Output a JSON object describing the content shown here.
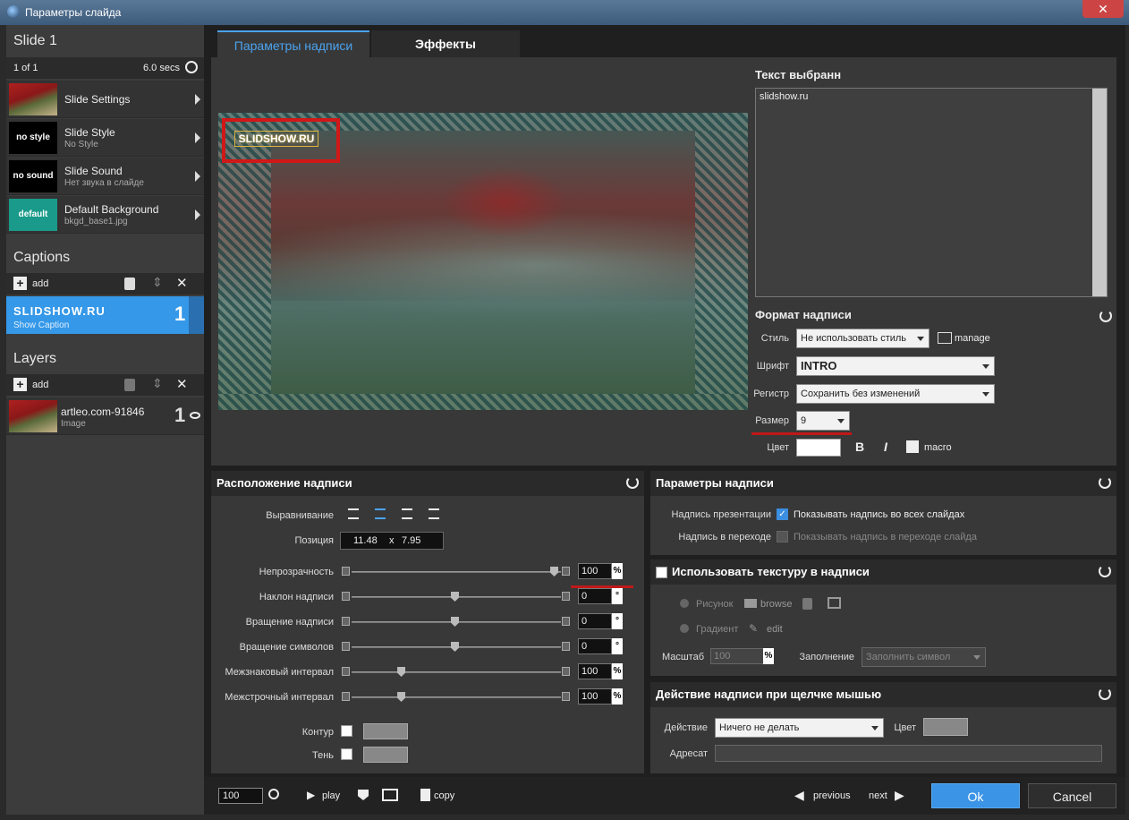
{
  "window": {
    "title": "Параметры слайда",
    "faint": "..."
  },
  "sidebar": {
    "slide_title": "Slide 1",
    "position": "1 of 1",
    "duration": "6.0 secs",
    "items": [
      {
        "title": "Slide Settings",
        "sub": "",
        "thumb": ""
      },
      {
        "title": "Slide Style",
        "sub": "No Style",
        "thumb": "no style"
      },
      {
        "title": "Slide Sound",
        "sub": "Нет звука в слайде",
        "thumb": "no sound"
      },
      {
        "title": "Default Background",
        "sub": "bkgd_base1.jpg",
        "thumb": "default"
      }
    ],
    "captions_label": "Captions",
    "add_label": "add",
    "caption_item": {
      "title": "SLIDSHOW.RU",
      "sub": "Show Caption",
      "num": "1"
    },
    "layers_label": "Layers",
    "layer_item": {
      "title": "artleo.com-91846",
      "sub": "Image",
      "num": "1"
    }
  },
  "tabs": {
    "caption_params": "Параметры надписи",
    "effects": "Эффекты"
  },
  "preview": {
    "caption_text": "SLIDSHOW.RU"
  },
  "text_panel": {
    "title": "Текст выбранн",
    "value": "slidshow.ru"
  },
  "format": {
    "title": "Формат надписи",
    "style_label": "Стиль",
    "style_value": "Не использовать стиль",
    "manage": "manage",
    "font_label": "Шрифт",
    "font_value": "INTRO",
    "case_label": "Регистр",
    "case_value": "Сохранить без изменений",
    "size_label": "Размер",
    "size_value": "9",
    "color_label": "Цвет",
    "bold": "B",
    "italic": "I",
    "macro": "macro"
  },
  "placement": {
    "title": "Расположение надписи",
    "align_label": "Выравнивание",
    "pos_label": "Позиция",
    "pos_x": "11.48",
    "pos_sep": "x",
    "pos_y": "7.95",
    "rows": [
      {
        "label": "Непрозрачность",
        "value": "100",
        "unit": "%",
        "level": 1.0
      },
      {
        "label": "Наклон надписи",
        "value": "0",
        "unit": "°",
        "level": 0.5
      },
      {
        "label": "Вращение надписи",
        "value": "0",
        "unit": "°",
        "level": 0.5
      },
      {
        "label": "Вращение символов",
        "value": "0",
        "unit": "°",
        "level": 0.5
      },
      {
        "label": "Межзнаковый интервал",
        "value": "100",
        "unit": "%",
        "level": 0.23
      },
      {
        "label": "Межстрочный интервал",
        "value": "100",
        "unit": "%",
        "level": 0.23
      }
    ],
    "outline_label": "Контур",
    "shadow_label": "Тень"
  },
  "caption_params": {
    "title": "Параметры надписи",
    "pres_label": "Надпись презентации",
    "pres_check": "Показывать надпись во всех слайдах",
    "trans_label": "Надпись в переходе",
    "trans_check": "Показывать надпись в переходе слайда"
  },
  "texture": {
    "title": "Использовать текстуру в надписи",
    "picture": "Рисунок",
    "browse": "browse",
    "gradient": "Градиент",
    "edit": "edit",
    "scale_label": "Масштаб",
    "scale_value": "100",
    "scale_unit": "%",
    "fill_label": "Заполнение",
    "fill_value": "Заполнить символ"
  },
  "click_action": {
    "title": "Действие надписи при щелчке мышью",
    "action_label": "Действие",
    "action_value": "Ничего не делать",
    "color_label": "Цвет",
    "target_label": "Адресат"
  },
  "bottom": {
    "zoom": "100",
    "play": "play",
    "copy": "copy",
    "previous": "previous",
    "next": "next",
    "ok": "Ok",
    "cancel": "Cancel"
  }
}
